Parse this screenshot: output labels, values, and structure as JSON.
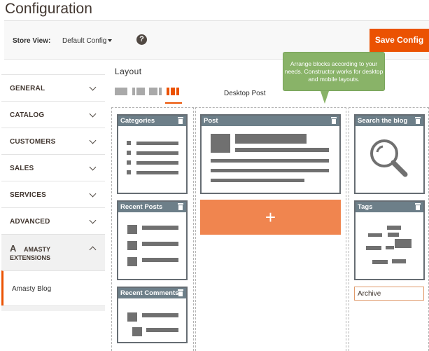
{
  "page": {
    "title": "Configuration"
  },
  "toolbar": {
    "store_view_label": "Store View:",
    "store_view_value": "Default Config",
    "help": "?",
    "save_label": "Save Config"
  },
  "sidebar": {
    "items": [
      {
        "label": "GENERAL"
      },
      {
        "label": "CATALOG"
      },
      {
        "label": "CUSTOMERS"
      },
      {
        "label": "SALES"
      },
      {
        "label": "SERVICES"
      },
      {
        "label": "ADVANCED"
      }
    ],
    "extensions": {
      "logo": "A",
      "line1": "AMASTY",
      "line2": "EXTENSIONS"
    },
    "sub_item": "Amasty Blog"
  },
  "layout": {
    "title": "Layout",
    "device_label": "Desktop Post",
    "tooltip": "Arrange blocks according to your needs. Constructor works for desktop and mobile layouts."
  },
  "blocks": {
    "categories": "Categories",
    "recent_posts": "Recent Posts",
    "recent_comments": "Recent Comments",
    "post": "Post",
    "search": "Search the blog",
    "tags": "Tags"
  },
  "add_button": "+",
  "archive_field": "Archive",
  "colors": {
    "accent": "#eb5202",
    "block_header": "#6d7f89",
    "tooltip": "#89b368",
    "add_button": "#f0854f"
  },
  "icons": [
    "help-icon",
    "chevron-down-icon",
    "chevron-up-icon",
    "trash-icon",
    "search-icon",
    "plus-icon",
    "amasty-logo-icon"
  ]
}
